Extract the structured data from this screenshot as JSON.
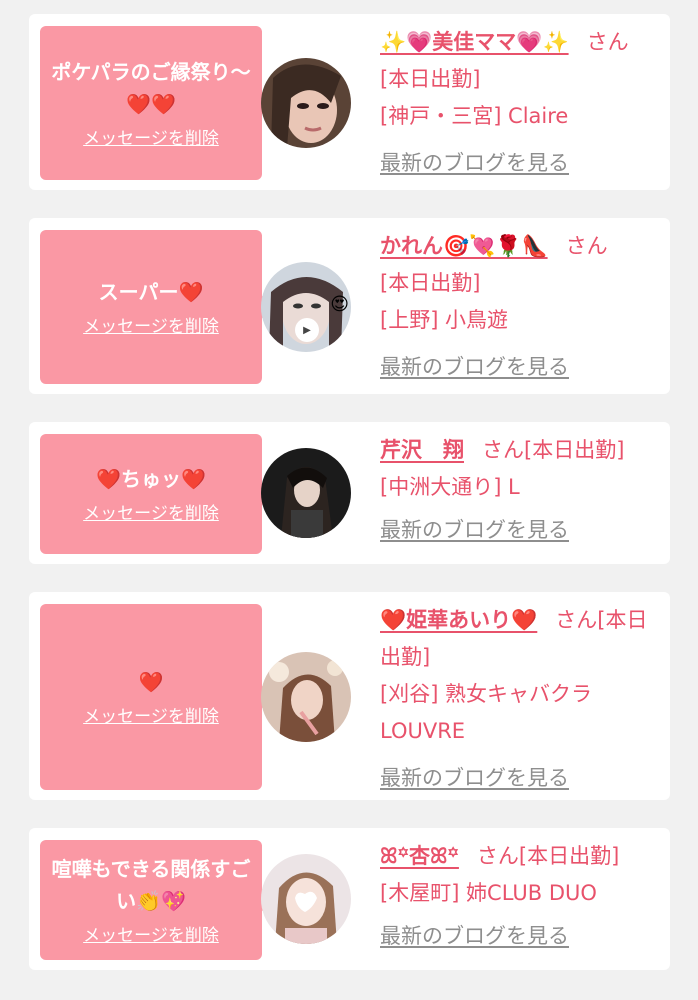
{
  "delete_label": "メッセージを削除",
  "san_label": "さん",
  "blog_label": "最新のブログを見る",
  "items": [
    {
      "message": "ポケパラのご縁祭り〜❤️❤️",
      "name": "✨💗美佳ママ💗✨",
      "status": "[本日出勤]",
      "location": "[神戸・三宮] Claire"
    },
    {
      "message": "スーパー❤️",
      "name": "かれん🎯💘🌹👠",
      "status": "[本日出勤]",
      "location": "[上野] 小鳥遊"
    },
    {
      "message": "❤️ちゅッ❤️",
      "name": "芹沢　翔",
      "status": "[本日出勤]",
      "location": "[中洲大通り] L"
    },
    {
      "message": "❤️",
      "name": "❤️姫華あいり❤️",
      "status": "[本日出勤]",
      "location": "[刈谷] 熟女キャバクラ LOUVRE"
    },
    {
      "message": "喧嘩もできる関係すごい👏💖",
      "name": "ꕤ꙳杏ꕤ꙳",
      "status": "[本日出勤]",
      "location": "[木屋町] 姉CLUB DUO"
    }
  ]
}
